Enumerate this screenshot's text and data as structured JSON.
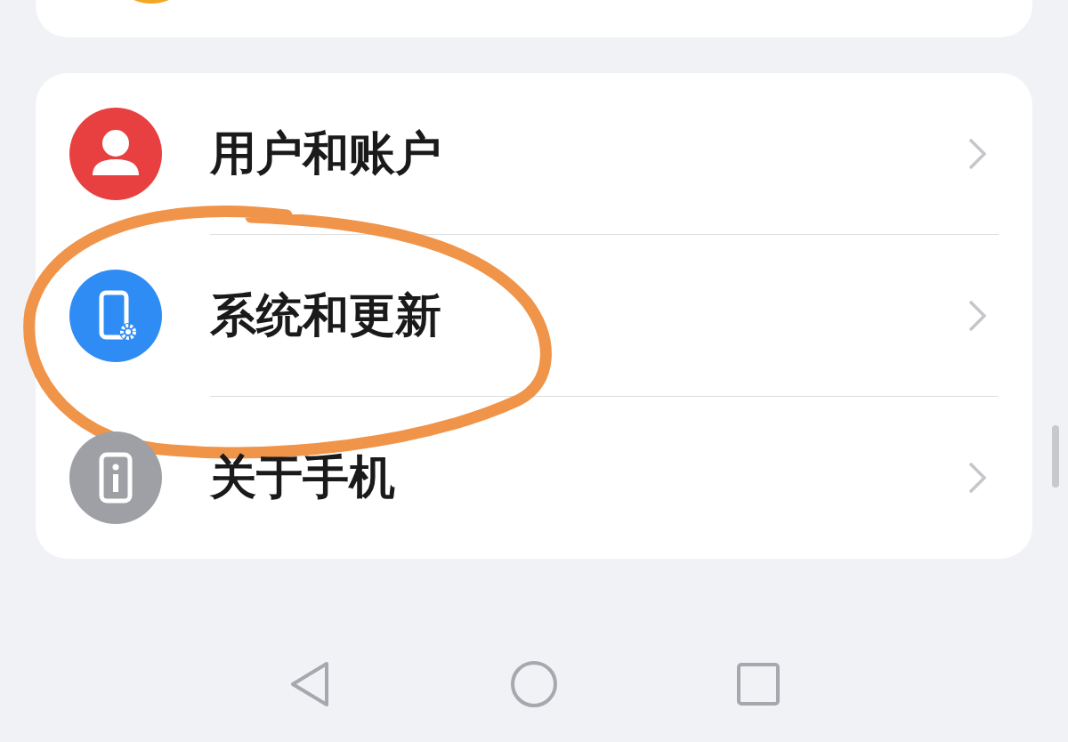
{
  "settings_items": [
    {
      "kind": "user",
      "label": "用户和账户",
      "color": "#e84040",
      "highlighted": false
    },
    {
      "kind": "system",
      "label": "系统和更新",
      "color": "#2f8cf5",
      "highlighted": true
    },
    {
      "kind": "about",
      "label": "关于手机",
      "color": "#9ea0a5",
      "highlighted": false
    }
  ],
  "navigation_bar": [
    {
      "kind": "back"
    },
    {
      "kind": "home"
    },
    {
      "kind": "recents"
    }
  ]
}
